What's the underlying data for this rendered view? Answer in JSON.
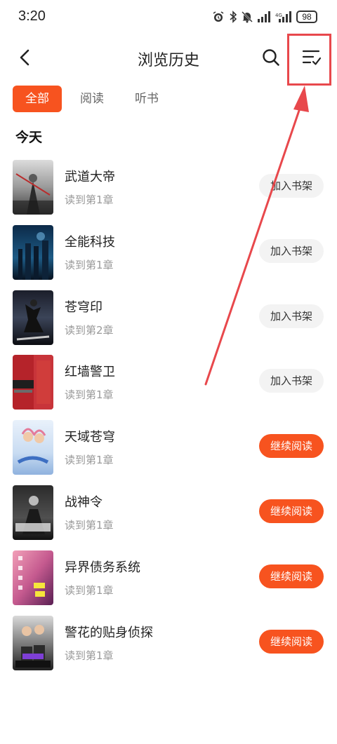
{
  "status_bar": {
    "time": "3:20",
    "battery": "98"
  },
  "header": {
    "title": "浏览历史",
    "back_icon": "back-arrow-icon",
    "search_icon": "search-icon",
    "manage_icon": "list-check-icon"
  },
  "tabs": [
    {
      "label": "全部",
      "active": true
    },
    {
      "label": "阅读",
      "active": false
    },
    {
      "label": "听书",
      "active": false
    }
  ],
  "section": {
    "title": "今天"
  },
  "books": [
    {
      "title": "武道大帝",
      "progress": "读到第1章",
      "action": "加入书架"
    },
    {
      "title": "全能科技",
      "progress": "读到第1章",
      "action": "加入书架"
    },
    {
      "title": "苍穹印",
      "progress": "读到第2章",
      "action": "加入书架"
    },
    {
      "title": "红墙警卫",
      "progress": "读到第1章",
      "action": "加入书架"
    },
    {
      "title": "天域苍穹",
      "progress": "读到第1章",
      "action": "继续阅读"
    },
    {
      "title": "战神令",
      "progress": "读到第1章",
      "action": "继续阅读"
    },
    {
      "title": "异界债务系统",
      "progress": "读到第1章",
      "action": "继续阅读"
    },
    {
      "title": "警花的贴身侦探",
      "progress": "读到第1章",
      "action": "继续阅读"
    }
  ],
  "colors": {
    "accent": "#f7531f",
    "annotation": "#e8484c"
  }
}
